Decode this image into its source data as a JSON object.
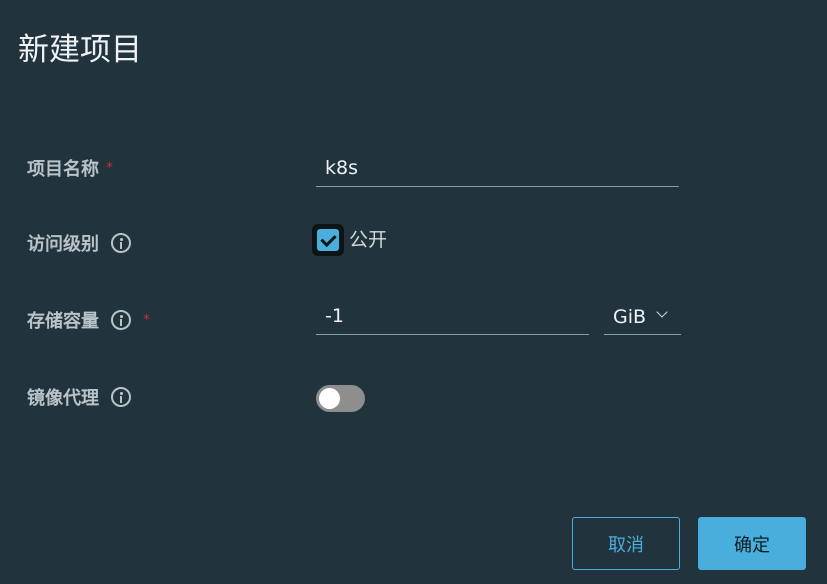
{
  "dialog": {
    "title": "新建项目"
  },
  "form": {
    "project_name": {
      "label": "项目名称",
      "required_mark": "*",
      "value": "k8s"
    },
    "access_level": {
      "label": "访问级别",
      "checkbox_label": "公开",
      "checked": true
    },
    "storage_quota": {
      "label": "存储容量",
      "required_mark": "*",
      "value": "-1",
      "unit": "GiB"
    },
    "proxy_cache": {
      "label": "镜像代理",
      "enabled": false
    }
  },
  "buttons": {
    "cancel_label": "取消",
    "ok_label": "确定"
  },
  "colors": {
    "background": "#21333c",
    "accent": "#49aedb",
    "required": "#c9302c",
    "toggle_off": "#8e8e8e"
  }
}
